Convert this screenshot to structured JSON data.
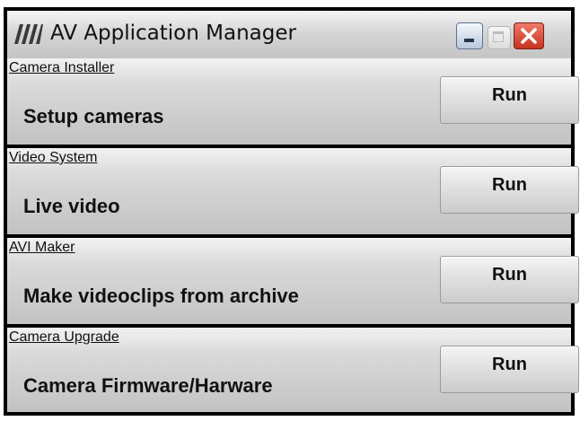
{
  "window": {
    "title": "AV Application Manager",
    "logo_icon": "av-logo-stripes-icon",
    "controls": {
      "minimize_icon": "minimize-icon",
      "maximize_icon": "maximize-icon",
      "close_icon": "close-icon"
    }
  },
  "apps": [
    {
      "title": "Camera Installer",
      "description": "Setup cameras",
      "button_label": "Run"
    },
    {
      "title": "Video System",
      "description": "Live video",
      "button_label": "Run"
    },
    {
      "title": "AVI Maker",
      "description": "Make videoclips from archive",
      "button_label": "Run"
    },
    {
      "title": "Camera Upgrade",
      "description": "Camera Firmware/Harware",
      "button_label": "Run"
    }
  ],
  "colors": {
    "close_button": "#c7321f",
    "minimize_button": "#b9c8dc",
    "frame": "#000000"
  }
}
